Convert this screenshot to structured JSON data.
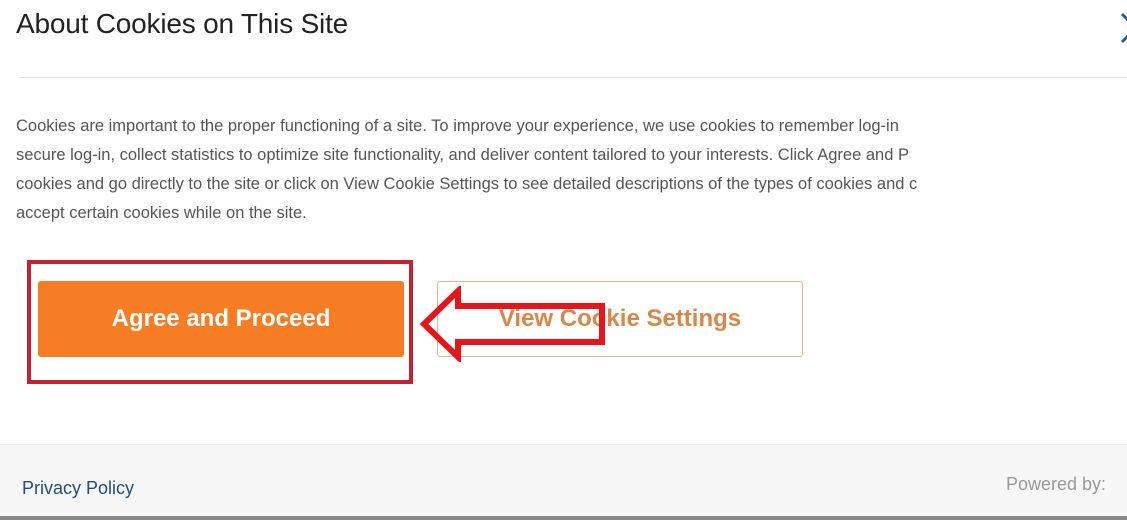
{
  "dialog": {
    "title": "About Cookies on This Site",
    "close_icon": "close-icon",
    "body_lines": [
      "Cookies are important to the proper functioning of a site. To improve your experience, we use cookies to remember log-in",
      "secure log-in, collect statistics to optimize site functionality, and deliver content tailored to your interests. Click Agree and P",
      "cookies and go directly to the site or click on View Cookie Settings to see detailed descriptions of the types of cookies and c",
      "accept certain cookies while on the site."
    ],
    "agree_label": "Agree and Proceed",
    "settings_label": "View Cookie Settings",
    "annotation_icon": "left-arrow-icon"
  },
  "footer": {
    "privacy_label": "Privacy Policy",
    "powered_label": "Powered by:"
  },
  "colors": {
    "accent": "#f77d24",
    "highlight": "#c7202f",
    "arrow": "#e8141b",
    "link": "#1f4f7e"
  }
}
